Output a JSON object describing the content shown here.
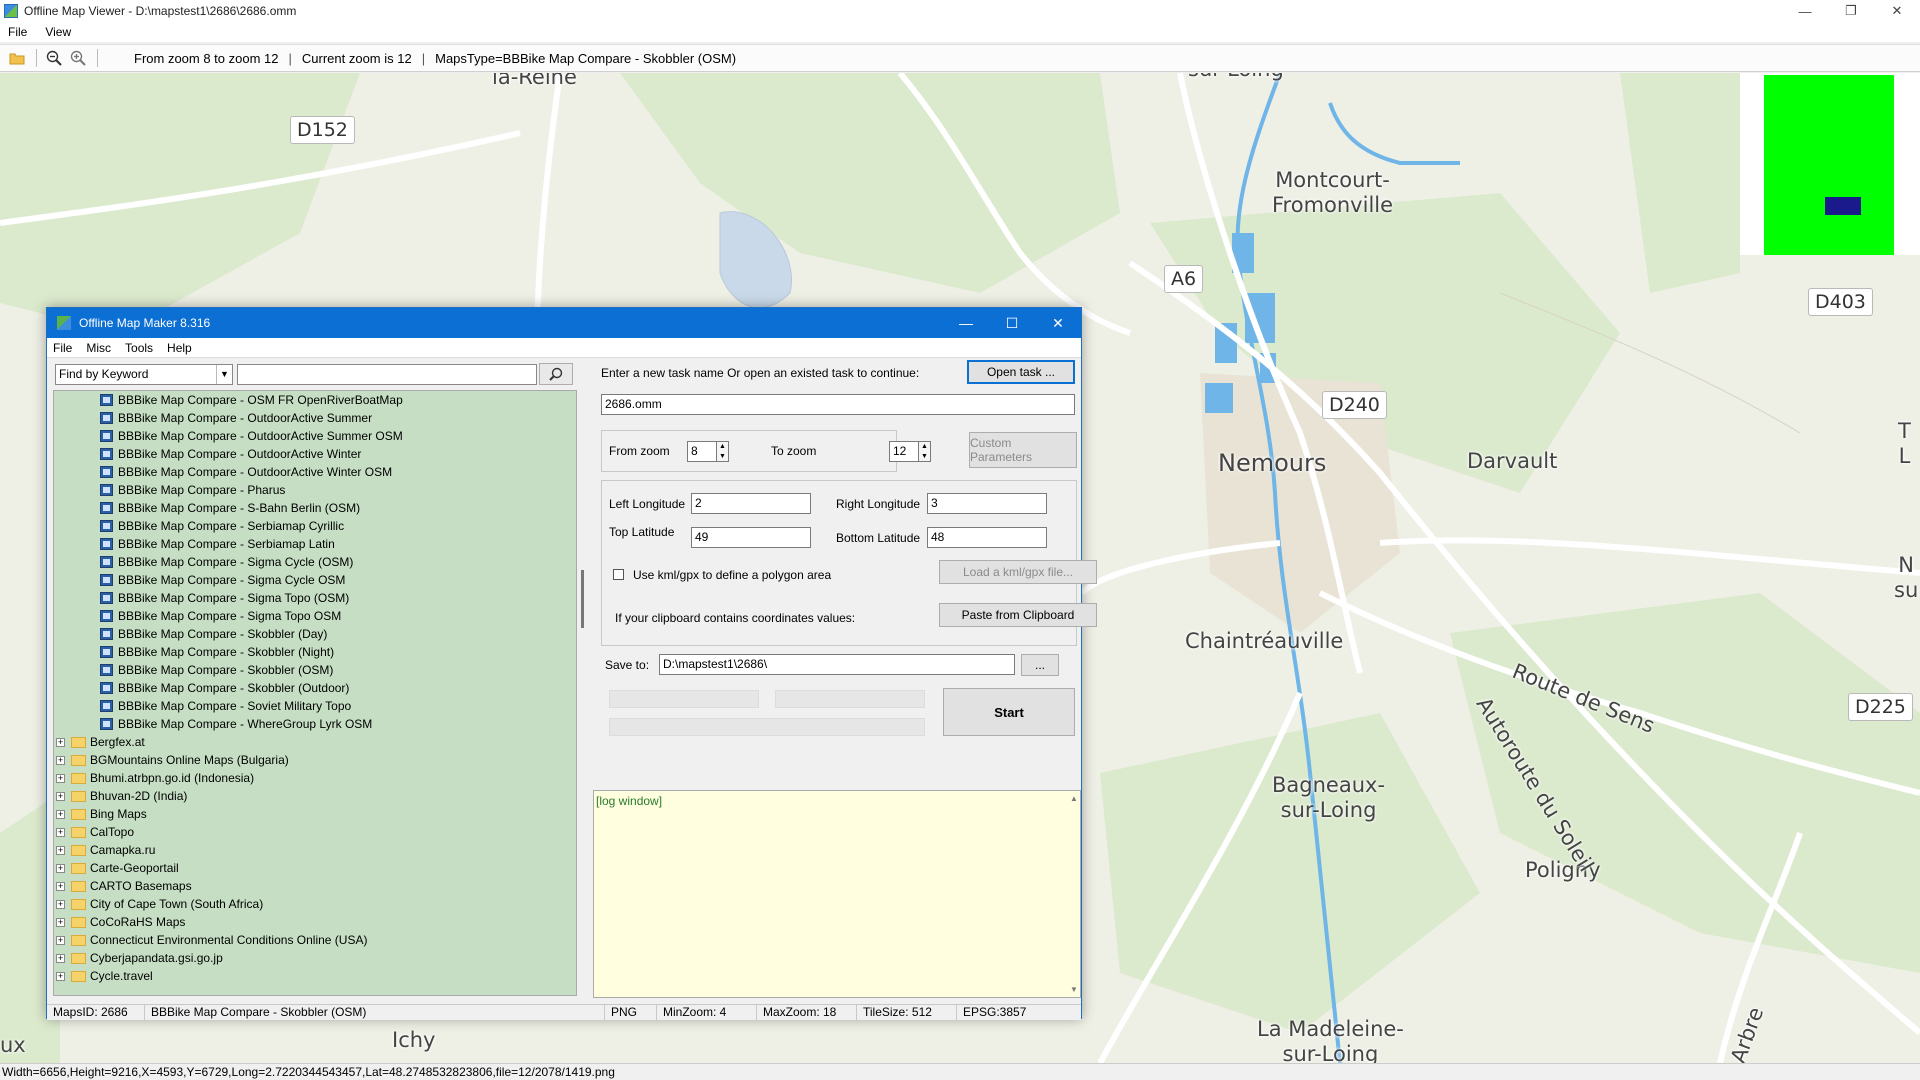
{
  "viewer": {
    "title": "Offline Map Viewer - D:\\mapstest1\\2686\\2686.omm",
    "window_controls": {
      "minimize": "—",
      "restore": "❐",
      "close": "✕"
    },
    "menu": [
      "File",
      "View"
    ],
    "toolbar": {
      "zoom_range": "From zoom 8 to zoom 12",
      "current_zoom": "Current zoom is 12",
      "maps_type": "MapsType=BBBike Map Compare - Skobbler (OSM)"
    },
    "status": "Width=6656,Height=9216,X=4593,Y=6729,Long=2.7220344543457,Lat=48.2748532823806,file=12/2078/1419.png"
  },
  "map": {
    "places": [
      "la-Reine",
      "Montcourt-\nFromonville",
      "Nemours",
      "Darvault",
      "Chaintréauville",
      "Bagneaux-\nsur-Loing",
      "Poligny",
      "La Madeleine-\nsur-Loing",
      "Ichy",
      "ux",
      "N\nsu",
      "T\nL",
      "Route de Sens",
      "Autoroute du Soleil",
      "Arbre",
      "sur-Loing"
    ],
    "roads": [
      "D152",
      "A6",
      "D403",
      "D240",
      "D225",
      "D403"
    ]
  },
  "dialog": {
    "title": "Offline Map Maker 8.316",
    "window_controls": {
      "minimize": "—",
      "maximize": "☐",
      "close": "✕"
    },
    "menu": [
      "File",
      "Misc",
      "Tools",
      "Help"
    ],
    "find": {
      "mode": "Find by Keyword",
      "query": ""
    },
    "tree": {
      "children": [
        "BBBike Map Compare - OSM FR OpenRiverBoatMap",
        "BBBike Map Compare - OutdoorActive Summer",
        "BBBike Map Compare - OutdoorActive Summer OSM",
        "BBBike Map Compare - OutdoorActive Winter",
        "BBBike Map Compare - OutdoorActive Winter OSM",
        "BBBike Map Compare - Pharus",
        "BBBike Map Compare - S-Bahn Berlin (OSM)",
        "BBBike Map Compare - Serbiamap Cyrillic",
        "BBBike Map Compare - Serbiamap Latin",
        "BBBike Map Compare - Sigma Cycle (OSM)",
        "BBBike Map Compare - Sigma Cycle OSM",
        "BBBike Map Compare - Sigma Topo (OSM)",
        "BBBike Map Compare - Sigma Topo OSM",
        "BBBike Map Compare - Skobbler (Day)",
        "BBBike Map Compare - Skobbler (Night)",
        "BBBike Map Compare - Skobbler (OSM)",
        "BBBike Map Compare - Skobbler (Outdoor)",
        "BBBike Map Compare - Soviet Military Topo",
        "BBBike Map Compare - WhereGroup Lyrk OSM"
      ],
      "folders": [
        "Bergfex.at",
        "BGMountains Online Maps (Bulgaria)",
        "Bhumi.atrbpn.go.id (Indonesia)",
        "Bhuvan-2D (India)",
        "Bing Maps",
        "CalTopo",
        "Camapka.ru",
        "Carte-Geoportail",
        "CARTO Basemaps",
        "City of Cape Town (South Africa)",
        "CoCoRaHS Maps",
        "Connecticut Environmental Conditions Online (USA)",
        "Cyberjapandata.gsi.go.jp",
        "Cycle.travel"
      ]
    },
    "task_label": "Enter a new task name Or open an existed task to continue:",
    "open_task": "Open task ...",
    "task_name": "2686.omm",
    "from_zoom_label": "From zoom",
    "from_zoom": "8",
    "to_zoom_label": "To zoom",
    "to_zoom": "12",
    "custom_params": "Custom Parameters",
    "left_lon_label": "Left Longitude",
    "left_lon": "2",
    "right_lon_label": "Right Longitude",
    "right_lon": "3",
    "top_lat_label": "Top Latitude",
    "top_lat": "49",
    "bottom_lat_label": "Bottom Latitude",
    "bottom_lat": "48",
    "kml_label": "Use kml/gpx to define a polygon area",
    "kml_button": "Load a kml/gpx file...",
    "clipboard_label": "If your clipboard contains coordinates values:",
    "clipboard_button": "Paste from Clipboard",
    "save_label": "Save to:",
    "save_path": "D:\\mapstest1\\2686\\",
    "browse": "...",
    "start": "Start",
    "log": "[log window]",
    "status": {
      "maps_id": "MapsID: 2686",
      "map_name": "BBBike Map Compare - Skobbler (OSM)",
      "format": "PNG",
      "min_zoom": "MinZoom: 4",
      "max_zoom": "MaxZoom: 18",
      "tile_size": "TileSize: 512",
      "epsg": "EPSG:3857"
    }
  },
  "colors": {
    "map_bg": "#eef0e6",
    "water": "#6fb5e8",
    "tree_bg": "#c6dfc4",
    "dialog_title": "#0b6fd4",
    "log_bg": "#ffffe0"
  }
}
